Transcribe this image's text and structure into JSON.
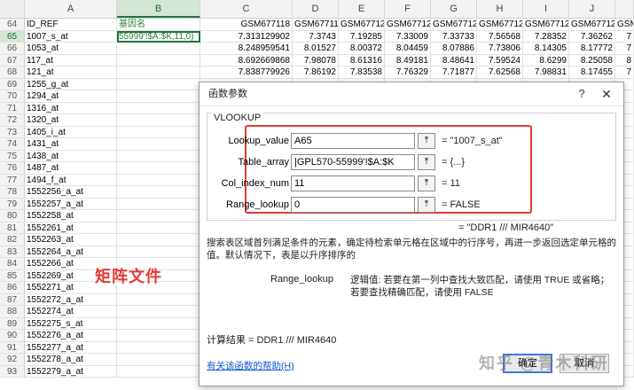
{
  "sheet": {
    "columns": [
      "",
      "A",
      "B",
      "C",
      "D",
      "E",
      "F",
      "G",
      "H",
      "I",
      "J",
      ""
    ],
    "headers": [
      "64",
      "ID_REF",
      "基因名",
      "GSM677118",
      "GSM67711",
      "GSM67712",
      "GSM67712",
      "GSM67712",
      "GSM67712",
      "GSM67712",
      "GSM67712",
      "GSM"
    ],
    "rows": [
      [
        "65",
        "1007_s_at",
        "55999'!$A:$K,11,0)",
        "7.313129902",
        "7.3743",
        "7.19285",
        "7.33009",
        "7.33733",
        "7.56568",
        "7.28352",
        "7.36262",
        "7"
      ],
      [
        "66",
        "1053_at",
        "",
        "8.248959541",
        "8.01527",
        "8.00372",
        "8.04459",
        "8.07886",
        "7.73806",
        "8.14305",
        "8.17772",
        "7"
      ],
      [
        "67",
        "117_at",
        "",
        "8.692669868",
        "7.98078",
        "8.61316",
        "8.49181",
        "8.48641",
        "7.59524",
        "8.6299",
        "8.25058",
        "8"
      ],
      [
        "68",
        "121_at",
        "",
        "7.838779926",
        "7.86192",
        "7.83538",
        "7.76329",
        "7.71877",
        "7.62568",
        "7.98831",
        "8.17455",
        "7"
      ],
      [
        "69",
        "1255_g_at",
        "",
        "",
        "",
        "",
        "",
        "",
        "",
        "",
        "",
        ""
      ],
      [
        "70",
        "1294_at",
        "",
        "",
        "",
        "",
        "",
        "",
        "",
        "",
        "",
        ""
      ],
      [
        "71",
        "1316_at",
        "",
        "",
        "",
        "",
        "",
        "",
        "",
        "",
        "",
        ""
      ],
      [
        "72",
        "1320_at",
        "",
        "",
        "",
        "",
        "",
        "",
        "",
        "",
        "",
        ""
      ],
      [
        "73",
        "1405_i_at",
        "",
        "",
        "",
        "",
        "",
        "",
        "",
        "",
        "",
        ""
      ],
      [
        "74",
        "1431_at",
        "",
        "",
        "",
        "",
        "",
        "",
        "",
        "",
        "",
        ""
      ],
      [
        "75",
        "1438_at",
        "",
        "",
        "",
        "",
        "",
        "",
        "",
        "",
        "",
        ""
      ],
      [
        "76",
        "1487_at",
        "",
        "",
        "",
        "",
        "",
        "",
        "",
        "",
        "",
        ""
      ],
      [
        "77",
        "1494_f_at",
        "",
        "",
        "",
        "",
        "",
        "",
        "",
        "",
        "",
        ""
      ],
      [
        "78",
        "1552256_a_at",
        "",
        "",
        "",
        "",
        "",
        "",
        "",
        "",
        "",
        ""
      ],
      [
        "79",
        "1552257_a_at",
        "",
        "",
        "",
        "",
        "",
        "",
        "",
        "",
        "",
        ""
      ],
      [
        "80",
        "1552258_at",
        "",
        "",
        "",
        "",
        "",
        "",
        "",
        "",
        "",
        ""
      ],
      [
        "81",
        "1552261_at",
        "",
        "",
        "",
        "",
        "",
        "",
        "",
        "",
        "",
        ""
      ],
      [
        "82",
        "1552263_at",
        "",
        "",
        "",
        "",
        "",
        "",
        "",
        "",
        "",
        ""
      ],
      [
        "83",
        "1552264_a_at",
        "",
        "",
        "",
        "",
        "",
        "",
        "",
        "",
        "",
        ""
      ],
      [
        "84",
        "1552266_at",
        "",
        "",
        "",
        "",
        "",
        "",
        "",
        "",
        "",
        ""
      ],
      [
        "85",
        "1552269_at",
        "",
        "",
        "",
        "",
        "",
        "",
        "",
        "",
        "",
        ""
      ],
      [
        "86",
        "1552271_at",
        "",
        "",
        "",
        "",
        "",
        "",
        "",
        "",
        "",
        ""
      ],
      [
        "87",
        "1552272_a_at",
        "",
        "",
        "",
        "",
        "",
        "",
        "",
        "",
        "",
        ""
      ],
      [
        "88",
        "1552274_at",
        "",
        "",
        "",
        "",
        "",
        "",
        "",
        "",
        "",
        ""
      ],
      [
        "89",
        "1552275_s_at",
        "",
        "",
        "",
        "",
        "",
        "",
        "",
        "",
        "",
        ""
      ],
      [
        "90",
        "1552276_a_at",
        "",
        "",
        "",
        "",
        "",
        "",
        "",
        "",
        "",
        ""
      ],
      [
        "91",
        "1552277_a_at",
        "",
        "",
        "",
        "",
        "",
        "",
        "",
        "",
        "",
        ""
      ],
      [
        "92",
        "1552278_a_at",
        "",
        "",
        "",
        "",
        "",
        "",
        "",
        "",
        "",
        ""
      ],
      [
        "93",
        "1552279_a_at",
        "",
        "",
        "",
        "",
        "",
        "",
        "",
        "",
        "",
        ""
      ]
    ],
    "overlay_label": "矩阵文件"
  },
  "dialog": {
    "title": "函数参数",
    "help_glyph": "?",
    "close_glyph": "✕",
    "function_name": "VLOOKUP",
    "args": [
      {
        "label": "Lookup_value",
        "value": "A65",
        "result": "=  \"1007_s_at\""
      },
      {
        "label": "Table_array",
        "value": "|GPL570-55999'!$A:$K",
        "result": "=  {...}"
      },
      {
        "label": "Col_index_num",
        "value": "11",
        "result": "=  11"
      },
      {
        "label": "Range_lookup",
        "value": "0",
        "result": "=  FALSE"
      }
    ],
    "collapse_glyph": "⤒",
    "formula_result": "=  \"DDR1 /// MIR4640\"",
    "description": "搜索表区域首列满足条件的元素，确定待检索单元格在区域中的行序号，再进一步返回选定单元格的值。默认情况下，表是以升序排序的",
    "param_name": "Range_lookup",
    "param_description": "逻辑值: 若要在第一列中查找大致匹配，请使用 TRUE 或省略；若要查找精确匹配，请使用 FALSE",
    "calc_result": "计算结果 =   DDR1 /// MIR4640",
    "help_link": "有关该函数的帮助(H)",
    "ok_label": "确定",
    "cancel_label": "取消"
  },
  "watermark": "知乎 @青木科研",
  "colors": {
    "accent": "#217346",
    "highlight": "#e53935",
    "link": "#0b57d0"
  }
}
